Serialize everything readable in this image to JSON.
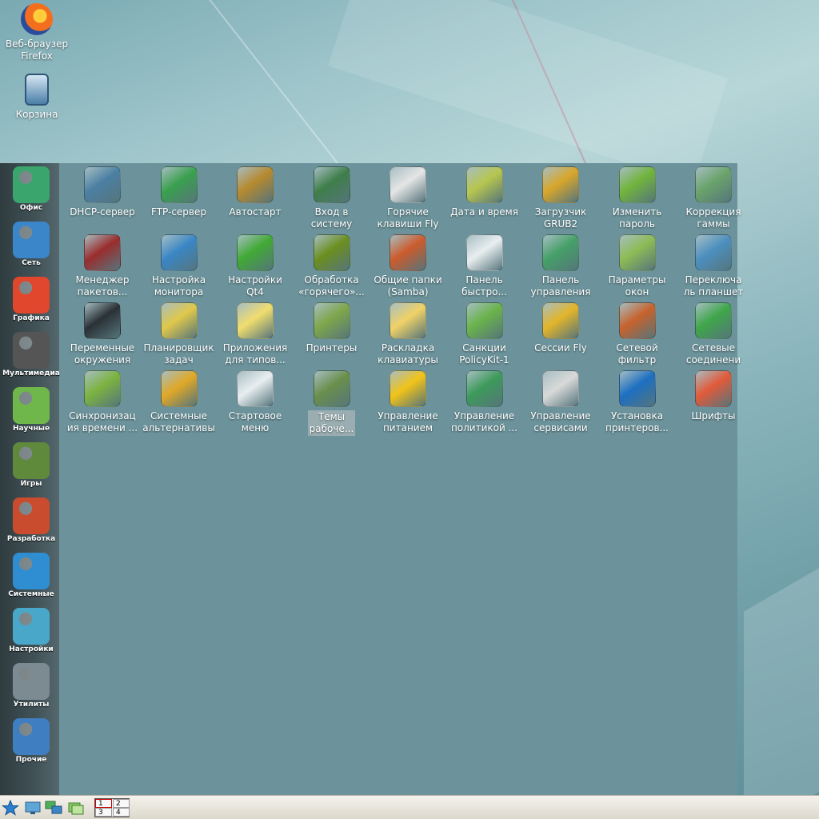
{
  "desktop": {
    "icons": [
      {
        "label": "Веб-браузер\nFirefox",
        "icon": "firefox-icon"
      },
      {
        "label": "Корзина",
        "icon": "trash-icon"
      }
    ]
  },
  "categories": [
    {
      "label": "Офис",
      "icon": "typewriter-icon",
      "color": "#3aa56c"
    },
    {
      "label": "Сеть",
      "icon": "globe-icon",
      "color": "#3b86c9"
    },
    {
      "label": "Графика",
      "icon": "paint-brushes-icon",
      "color": "#e0472d"
    },
    {
      "label": "Мультимедиа",
      "icon": "clapperboard-icon",
      "color": "#555555"
    },
    {
      "label": "Научные",
      "icon": "whiteboard-icon",
      "color": "#6fb74a"
    },
    {
      "label": "Игры",
      "icon": "joystick-icon",
      "color": "#5f8a3c"
    },
    {
      "label": "Разработка",
      "icon": "hammer-icon",
      "color": "#c84c2d"
    },
    {
      "label": "Системные",
      "icon": "gear-icon",
      "color": "#2f8ed2"
    },
    {
      "label": "Настройки",
      "icon": "monitor-settings-icon",
      "color": "#49a8c9"
    },
    {
      "label": "Утилиты",
      "icon": "compass-icon",
      "color": "#7c8a92"
    },
    {
      "label": "Прочие",
      "icon": "disc-icon",
      "color": "#3f7fc1"
    }
  ],
  "apps": [
    {
      "label": "DHCP-сервер",
      "icon": "dhcp-monitor-icon",
      "color": "#4b7fa3"
    },
    {
      "label": "FTP-сервер",
      "icon": "ftp-globe-icon",
      "color": "#3aa04e"
    },
    {
      "label": "Автостарт",
      "icon": "runner-icon",
      "color": "#b6892f"
    },
    {
      "label": "Вход в\nсистему",
      "icon": "login-monitor-icon",
      "color": "#3f7e4a"
    },
    {
      "label": "Горячие\nклавиши Fly",
      "icon": "hotkeys-flame-icon",
      "color": "#e5e5e5"
    },
    {
      "label": "Дата и время",
      "icon": "clock-calendar-icon",
      "color": "#b7c64e"
    },
    {
      "label": "Загрузчик\nGRUB2",
      "icon": "forklift-icon",
      "color": "#d8a62a"
    },
    {
      "label": "Изменить\nпароль",
      "icon": "user-lock-icon",
      "color": "#71b43c"
    },
    {
      "label": "Коррекция\nгаммы",
      "icon": "gamma-monitor-icon",
      "color": "#6aa36b"
    },
    {
      "label": "Менеджер\nпакетов...",
      "icon": "package-manager-icon",
      "color": "#9a2d2d"
    },
    {
      "label": "Настройка\nмонитора",
      "icon": "monitor-gear-icon",
      "color": "#3a86c5"
    },
    {
      "label": "Настройки\nQt4",
      "icon": "qt-icon",
      "color": "#41a934"
    },
    {
      "label": "Обработка\n«горячего»...",
      "icon": "usb-icon",
      "color": "#6b8e1f"
    },
    {
      "label": "Общие папки\n(Samba)",
      "icon": "samba-share-icon",
      "color": "#cc5b2c"
    },
    {
      "label": "Панель\nбыстро...",
      "icon": "quick-panel-icon",
      "color": "#e9eef0"
    },
    {
      "label": "Панель\nуправления",
      "icon": "control-panel-icon",
      "color": "#45a067"
    },
    {
      "label": "Параметры\nокон",
      "icon": "windows-params-icon",
      "color": "#8dbb54"
    },
    {
      "label": "Переключа\nль планшет",
      "icon": "tablet-switch-icon",
      "color": "#4c8fbf"
    },
    {
      "label": "Переменные\nокружения",
      "icon": "terminal-icon",
      "color": "#2a3136"
    },
    {
      "label": "Планировщик\nзадач",
      "icon": "scheduler-clock-icon",
      "color": "#e0c84a"
    },
    {
      "label": "Приложения\nдля типов...",
      "icon": "document-types-icon",
      "color": "#f1dd6e"
    },
    {
      "label": "Принтеры",
      "icon": "printer-icon",
      "color": "#7ea64a"
    },
    {
      "label": "Раскладка\nклавиатуры",
      "icon": "keyboard-icon",
      "color": "#f0d266"
    },
    {
      "label": "Санкции\nPolicyKit-1",
      "icon": "policykit-lock-icon",
      "color": "#6ab34a"
    },
    {
      "label": "Сессии Fly",
      "icon": "session-refresh-icon",
      "color": "#e3b52a"
    },
    {
      "label": "Сетевой\nфильтр",
      "icon": "firewall-icon",
      "color": "#c7622c"
    },
    {
      "label": "Сетевые\nсоединени",
      "icon": "antenna-icon",
      "color": "#3fa64a"
    },
    {
      "label": "Синхронизац\nия времени ...",
      "icon": "time-sync-clock-icon",
      "color": "#7cb340"
    },
    {
      "label": "Системные\nальтернативы",
      "icon": "gears-icon",
      "color": "#e0a827"
    },
    {
      "label": "Стартовое\nменю",
      "icon": "start-menu-icon",
      "color": "#e9eef0"
    },
    {
      "label": "Темы\nрабоче...",
      "icon": "themes-helmet-icon",
      "color": "#6a8f4c"
    },
    {
      "label": "Управление\nпитанием",
      "icon": "power-warning-icon",
      "color": "#f2c318"
    },
    {
      "label": "Управление\nполитикой ...",
      "icon": "policy-shield-icon",
      "color": "#3d9a5a"
    },
    {
      "label": "Управление\nсервисами",
      "icon": "services-traffic-icon",
      "color": "#d9d9d9"
    },
    {
      "label": "Установка\nпринтеров...",
      "icon": "hp-printer-icon",
      "color": "#1d6fc2"
    },
    {
      "label": "Шрифты",
      "icon": "font-t-icon",
      "color": "#e25a3a"
    }
  ],
  "selected_app_index": 30,
  "taskbar": {
    "pager": [
      "1",
      "2",
      "3",
      "4"
    ]
  }
}
